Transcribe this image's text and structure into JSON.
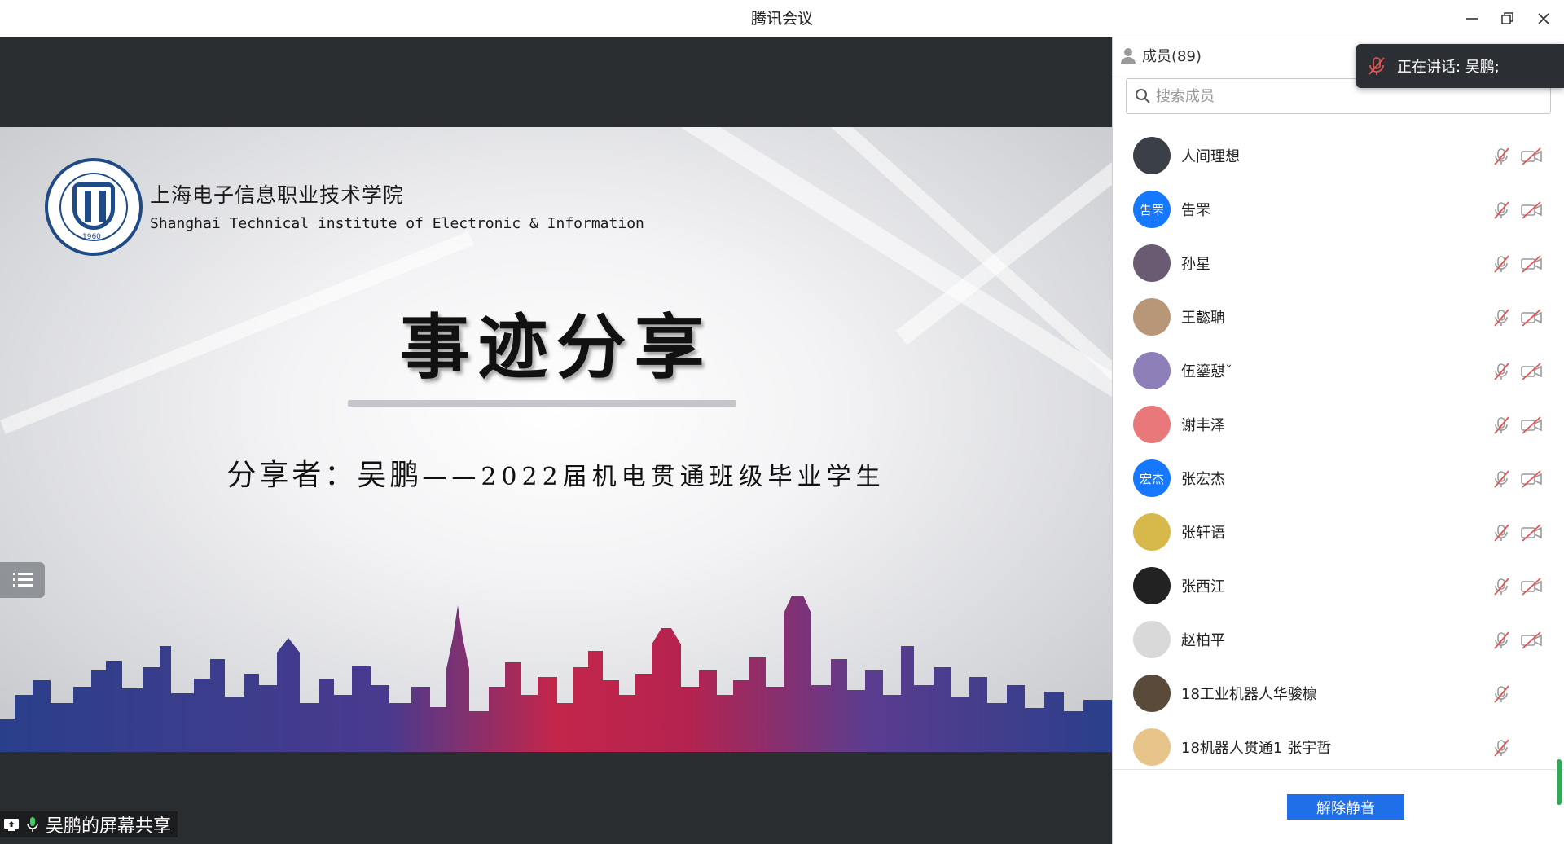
{
  "window": {
    "title": "腾讯会议"
  },
  "slide": {
    "school_cn": "上海电子信息职业技术学院",
    "school_en": "Shanghai Technical institute of Electronic & Information",
    "logo_year": "1960",
    "headline": "事迹分享",
    "subline_lead": "分享者：吴鹏",
    "subline_rest": "——2022届机电贯通班级毕业学生"
  },
  "stage": {
    "share_badge": "吴鹏的屏幕共享"
  },
  "panel": {
    "header": "成员(89)",
    "search_placeholder": "搜索成员",
    "members": [
      {
        "name": "人间理想",
        "avatar_color": "#3b3f48",
        "avatar_text": ""
      },
      {
        "name": "吿罘",
        "avatar_color": "#1677ff",
        "avatar_text": "吿罘"
      },
      {
        "name": "孙星",
        "avatar_color": "#6a5a72",
        "avatar_text": ""
      },
      {
        "name": "王懿聃",
        "avatar_color": "#b89678",
        "avatar_text": ""
      },
      {
        "name": "伍鎏憇ˇ",
        "avatar_color": "#8f7fb8",
        "avatar_text": ""
      },
      {
        "name": "谢丰泽",
        "avatar_color": "#e9787a",
        "avatar_text": ""
      },
      {
        "name": "张宏杰",
        "avatar_color": "#1677ff",
        "avatar_text": "宏杰"
      },
      {
        "name": "张轩语",
        "avatar_color": "#d7b84a",
        "avatar_text": ""
      },
      {
        "name": "张西江",
        "avatar_color": "#222222",
        "avatar_text": ""
      },
      {
        "name": "赵柏平",
        "avatar_color": "#d9d9d9",
        "avatar_text": ""
      },
      {
        "name": "18工业机器人华骏檩",
        "avatar_color": "#5a4a3a",
        "avatar_text": ""
      },
      {
        "name": "18机器人贯通1 张宇哲",
        "avatar_color": "#e7c48a",
        "avatar_text": ""
      }
    ],
    "unmute_button": "解除静音"
  },
  "toast": {
    "speaking": "正在讲话: 吴鹏;"
  },
  "colors": {
    "accent": "#1e6fe8",
    "muted_red": "#e05555",
    "school_blue": "#1e4a86"
  }
}
